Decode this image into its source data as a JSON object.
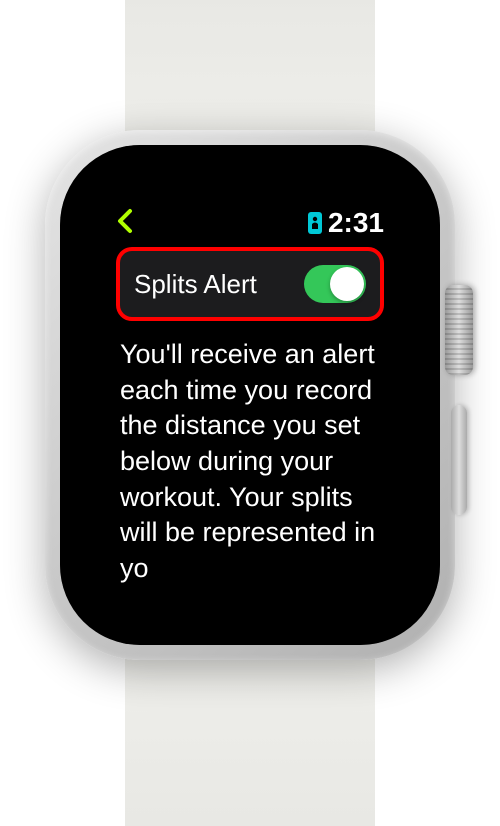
{
  "status_bar": {
    "time": "2:31"
  },
  "setting": {
    "label": "Splits Alert",
    "enabled": true
  },
  "description": "You'll receive an alert each time you record the distance you set below during your workout. Your splits will be represented in yo",
  "colors": {
    "accent_green": "#b0ff00",
    "toggle_on": "#34c759",
    "highlight_border": "#ff0000",
    "phone_icon": "#00c8d6"
  }
}
